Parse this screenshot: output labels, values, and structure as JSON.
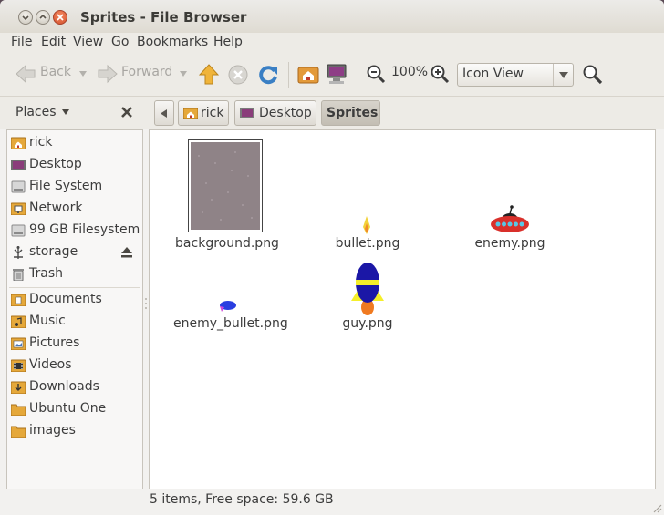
{
  "window": {
    "title": "Sprites - File Browser"
  },
  "menu": [
    "File",
    "Edit",
    "View",
    "Go",
    "Bookmarks",
    "Help"
  ],
  "toolbar": {
    "back_label": "Back",
    "forward_label": "Forward",
    "zoom_level": "100%",
    "view_mode": "Icon View",
    "icons": [
      "go-back-icon",
      "go-forward-icon",
      "go-up-icon",
      "stop-icon",
      "reload-icon",
      "home-icon",
      "computer-icon",
      "zoom-out-icon",
      "zoom-in-icon",
      "search-icon"
    ]
  },
  "places_label": "Places",
  "breadcrumbs": [
    "rick",
    "Desktop",
    "Sprites"
  ],
  "sidebar": {
    "items": [
      {
        "label": "rick",
        "icon": "home-folder-icon"
      },
      {
        "label": "Desktop",
        "icon": "desktop-icon"
      },
      {
        "label": "File System",
        "icon": "harddisk-icon"
      },
      {
        "label": "Network",
        "icon": "network-icon"
      },
      {
        "label": "99 GB Filesystem",
        "icon": "harddisk-icon"
      },
      {
        "label": "storage",
        "icon": "usb-drive-icon"
      },
      {
        "label": "Trash",
        "icon": "trash-icon"
      },
      {
        "label": "Documents",
        "icon": "documents-folder-icon"
      },
      {
        "label": "Music",
        "icon": "music-folder-icon"
      },
      {
        "label": "Pictures",
        "icon": "pictures-folder-icon"
      },
      {
        "label": "Videos",
        "icon": "videos-folder-icon"
      },
      {
        "label": "Downloads",
        "icon": "downloads-folder-icon"
      },
      {
        "label": "Ubuntu One",
        "icon": "folder-icon"
      },
      {
        "label": "images",
        "icon": "folder-icon"
      }
    ]
  },
  "files": [
    {
      "name": "background.png",
      "thumb": "background-thumbnail"
    },
    {
      "name": "bullet.png",
      "thumb": "bullet-thumbnail"
    },
    {
      "name": "enemy.png",
      "thumb": "enemy-ufo-thumbnail"
    },
    {
      "name": "enemy_bullet.png",
      "thumb": "enemy-bullet-thumbnail"
    },
    {
      "name": "guy.png",
      "thumb": "rocket-guy-thumbnail"
    }
  ],
  "status": "5 items, Free space: 59.6 GB",
  "colors": {
    "accent": "#e8692e",
    "folder": "#e5a83a",
    "desktop": "#8a3d7a"
  }
}
